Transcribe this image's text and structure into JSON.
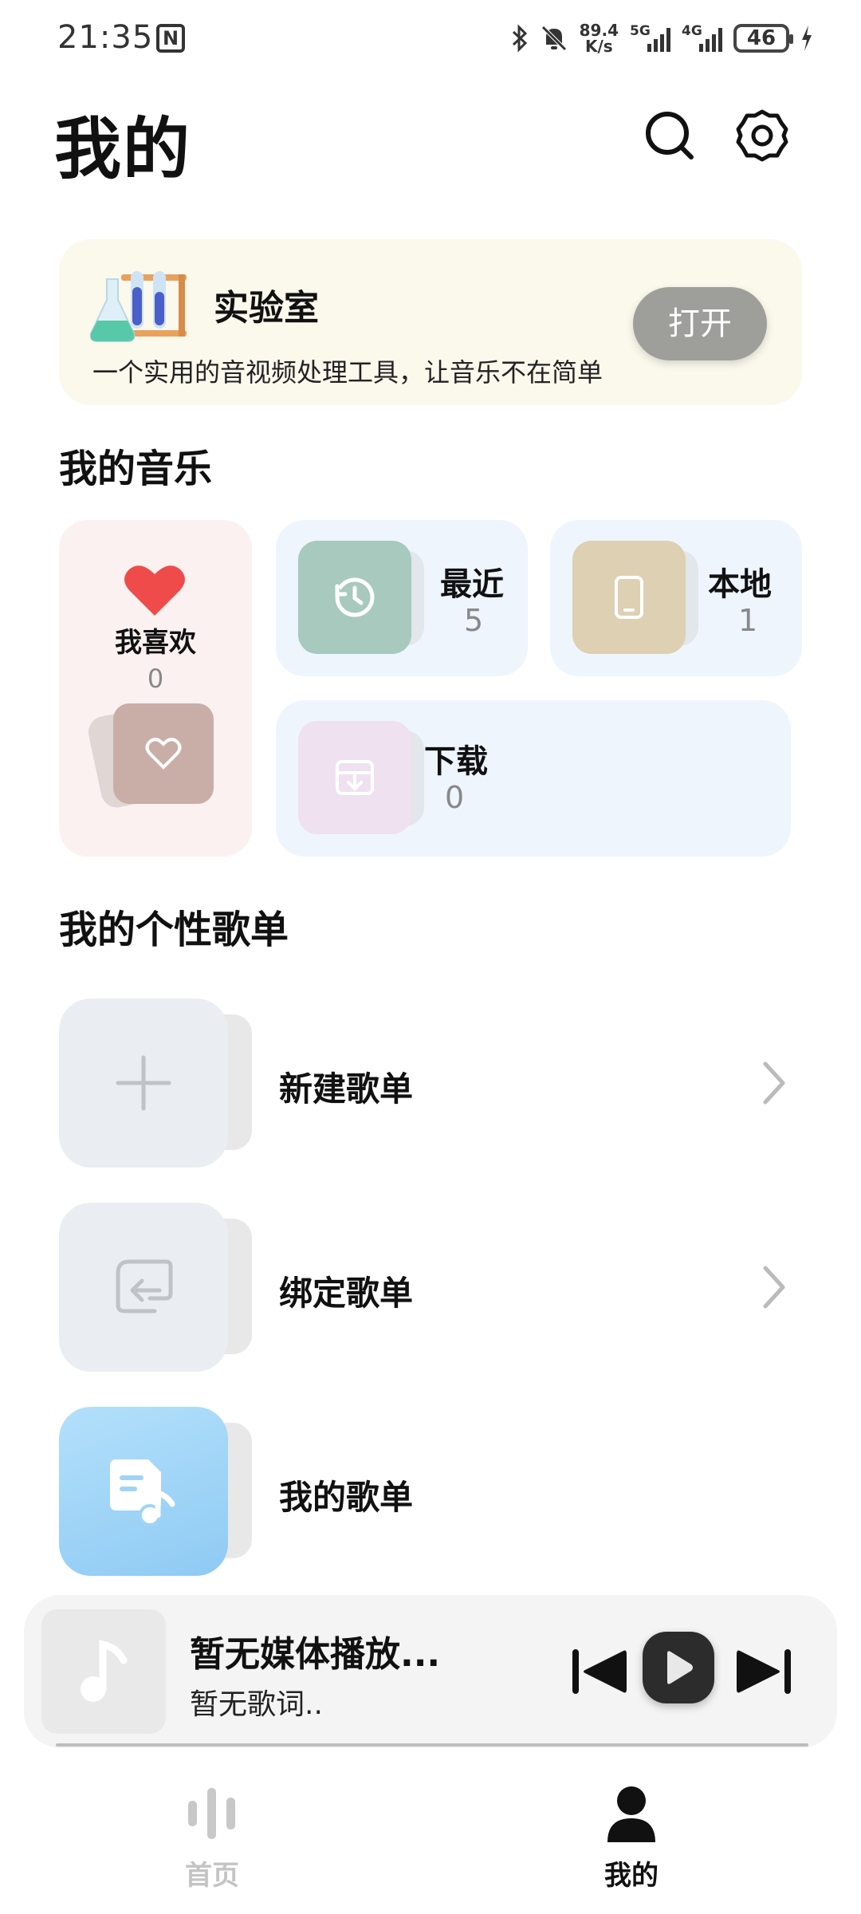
{
  "status_bar": {
    "time": "21:35",
    "nfc_badge": "N",
    "net_speed_value": "89.4",
    "net_speed_unit": "K/s",
    "signal1_label": "5G",
    "signal2_label": "4G",
    "battery": "46"
  },
  "header": {
    "title": "我的"
  },
  "lab_card": {
    "title": "实验室",
    "description": "一个实用的音视频处理工具，让音乐不在简单",
    "open_label": "打开"
  },
  "my_music": {
    "section_title": "我的音乐",
    "favorites": {
      "label": "我喜欢",
      "count": "0"
    },
    "recent": {
      "label": "最近",
      "count": "5"
    },
    "local": {
      "label": "本地",
      "count": "1"
    },
    "downloads": {
      "label": "下载",
      "count": "0"
    }
  },
  "playlists": {
    "section_title": "我的个性歌单",
    "new_label": "新建歌单",
    "bind_label": "绑定歌单",
    "mine_label": "我的歌单"
  },
  "player": {
    "title": "暂无媒体播放...",
    "lyric": "暂无歌词.."
  },
  "bottom_nav": {
    "home_label": "首页",
    "mine_label": "我的"
  },
  "colors": {
    "lab_bg": "#fbf8ec",
    "fav_bg": "#fcf1f1",
    "tile_bg": "#eef5fd",
    "heart": "#ef4b4b",
    "playlist_blue": "#9fd4f7"
  }
}
